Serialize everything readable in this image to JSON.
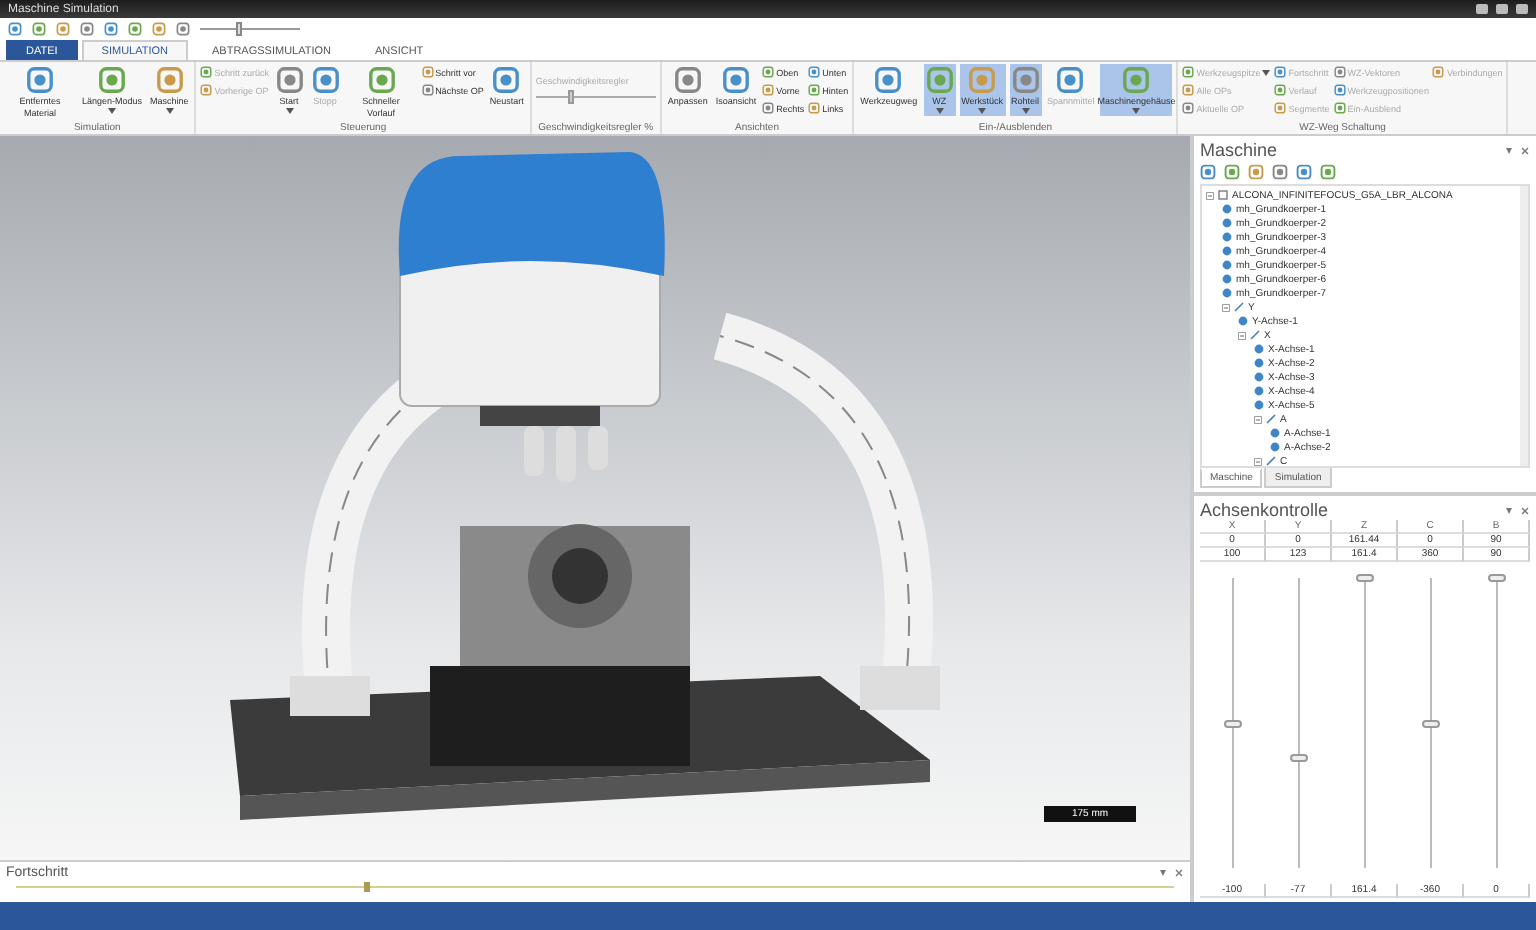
{
  "window": {
    "title": "Maschine Simulation"
  },
  "quick_access": {
    "slider": {
      "level": 0.35
    }
  },
  "tabs": [
    {
      "label": "DATEI",
      "kind": "file",
      "selected": false
    },
    {
      "label": "SIMULATION",
      "kind": "tab",
      "selected": true
    },
    {
      "label": "ABTRAGSSIMULATION",
      "kind": "tab",
      "selected": false
    },
    {
      "label": "ANSICHT",
      "kind": "tab",
      "selected": false
    }
  ],
  "ribbon": {
    "groups": [
      {
        "label": "Simulation",
        "items": [
          {
            "label": "Entferntes Material",
            "kind": "large",
            "disabled": false,
            "selected": false,
            "dropdown": false
          },
          {
            "label": "Längen-Modus",
            "kind": "large",
            "disabled": false,
            "selected": false,
            "dropdown": true
          },
          {
            "label": "Maschine",
            "kind": "large",
            "disabled": false,
            "selected": false,
            "dropdown": true
          }
        ]
      },
      {
        "label": "Steuerung",
        "items": [
          {
            "label": "Schritt zurück",
            "kind": "small",
            "disabled": true,
            "selected": false,
            "dropdown": false
          },
          {
            "label": "Vorherige OP",
            "kind": "small",
            "disabled": true,
            "selected": false,
            "dropdown": false
          },
          {
            "label": "Start",
            "kind": "large",
            "disabled": false,
            "selected": false,
            "dropdown": true
          },
          {
            "label": "Stopp",
            "kind": "large",
            "disabled": true,
            "selected": false,
            "dropdown": false
          },
          {
            "label": "Schneller Vorlauf",
            "kind": "large",
            "disabled": false,
            "selected": false,
            "dropdown": false
          },
          {
            "label": "Schritt vor",
            "kind": "small",
            "disabled": false,
            "selected": false,
            "dropdown": false
          },
          {
            "label": "Nächste OP",
            "kind": "small",
            "disabled": false,
            "selected": false,
            "dropdown": false
          },
          {
            "label": "Neustart",
            "kind": "large",
            "disabled": false,
            "selected": false,
            "dropdown": false
          }
        ]
      },
      {
        "label": "Geschwindigkeitsregler %",
        "items": [
          {
            "label": "Geschwindigkeitsregler",
            "kind": "slider",
            "level": 0.3,
            "disabled": true
          }
        ]
      },
      {
        "label": "Ansichten",
        "items": [
          {
            "label": "Anpassen",
            "kind": "large",
            "disabled": false,
            "selected": false,
            "dropdown": false
          },
          {
            "label": "Isoansicht",
            "kind": "large",
            "disabled": false,
            "selected": false,
            "dropdown": false
          },
          {
            "label": "Oben",
            "kind": "small",
            "disabled": false,
            "selected": false,
            "dropdown": false
          },
          {
            "label": "Vorne",
            "kind": "small",
            "disabled": false,
            "selected": false,
            "dropdown": false
          },
          {
            "label": "Rechts",
            "kind": "small",
            "disabled": false,
            "selected": false,
            "dropdown": false
          },
          {
            "label": "Unten",
            "kind": "small",
            "disabled": false,
            "selected": false,
            "dropdown": false
          },
          {
            "label": "Hinten",
            "kind": "small",
            "disabled": false,
            "selected": false,
            "dropdown": false
          },
          {
            "label": "Links",
            "kind": "small",
            "disabled": false,
            "selected": false,
            "dropdown": false
          }
        ]
      },
      {
        "label": "Ein-/Ausblenden",
        "items": [
          {
            "label": "Werkzeugweg",
            "kind": "large",
            "disabled": false,
            "selected": false,
            "dropdown": false
          },
          {
            "label": "WZ",
            "kind": "large",
            "disabled": false,
            "selected": true,
            "dropdown": true
          },
          {
            "label": "Werkstück",
            "kind": "large",
            "disabled": false,
            "selected": true,
            "dropdown": true
          },
          {
            "label": "Rohteil",
            "kind": "large",
            "disabled": false,
            "selected": true,
            "dropdown": true
          },
          {
            "label": "Spannmittel",
            "kind": "large",
            "disabled": true,
            "selected": false,
            "dropdown": false
          },
          {
            "label": "Maschinengehäuse",
            "kind": "large",
            "disabled": false,
            "selected": true,
            "dropdown": true
          }
        ]
      },
      {
        "label": "WZ-Weg Schaltung",
        "items": [
          {
            "label": "Werkzeugspitze",
            "kind": "small",
            "disabled": true,
            "selected": false,
            "dropdown": true
          },
          {
            "label": "Alle OPs",
            "kind": "small",
            "disabled": true,
            "selected": false,
            "dropdown": false
          },
          {
            "label": "Aktuelle OP",
            "kind": "small",
            "disabled": true,
            "selected": false,
            "dropdown": false
          },
          {
            "label": "Fortschritt",
            "kind": "small",
            "disabled": true,
            "selected": false,
            "dropdown": false
          },
          {
            "label": "Verlauf",
            "kind": "small",
            "disabled": true,
            "selected": false,
            "dropdown": false
          },
          {
            "label": "Segmente",
            "kind": "small",
            "disabled": true,
            "selected": false,
            "dropdown": false
          },
          {
            "label": "WZ-Vektoren",
            "kind": "small",
            "disabled": true,
            "selected": false,
            "dropdown": false
          },
          {
            "label": "Werkzeugpositionen",
            "kind": "small",
            "disabled": true,
            "selected": false,
            "dropdown": false
          },
          {
            "label": "Ein-Ausblend",
            "kind": "small",
            "disabled": true,
            "selected": false,
            "dropdown": false
          },
          {
            "label": "Verbindungen",
            "kind": "small",
            "disabled": true,
            "selected": false,
            "dropdown": false
          }
        ]
      }
    ]
  },
  "viewport": {
    "scale_label": "175 mm"
  },
  "machine_panel": {
    "title": "Maschine",
    "tree": [
      {
        "label": "ALCONA_INFINITEFOCUS_G5A_LBR_ALCONA",
        "kind": "root",
        "expanded": true,
        "children": [
          {
            "label": "mh_Grundkoerper-1",
            "kind": "body"
          },
          {
            "label": "mh_Grundkoerper-2",
            "kind": "body"
          },
          {
            "label": "mh_Grundkoerper-3",
            "kind": "body"
          },
          {
            "label": "mh_Grundkoerper-4",
            "kind": "body"
          },
          {
            "label": "mh_Grundkoerper-5",
            "kind": "body"
          },
          {
            "label": "mh_Grundkoerper-6",
            "kind": "body"
          },
          {
            "label": "mh_Grundkoerper-7",
            "kind": "body"
          },
          {
            "label": "Y",
            "kind": "axis",
            "expanded": true,
            "children": [
              {
                "label": "Y-Achse-1",
                "kind": "body"
              },
              {
                "label": "X",
                "kind": "axis",
                "expanded": true,
                "children": [
                  {
                    "label": "X-Achse-1",
                    "kind": "body"
                  },
                  {
                    "label": "X-Achse-2",
                    "kind": "body"
                  },
                  {
                    "label": "X-Achse-3",
                    "kind": "body"
                  },
                  {
                    "label": "X-Achse-4",
                    "kind": "body"
                  },
                  {
                    "label": "X-Achse-5",
                    "kind": "body"
                  },
                  {
                    "label": "A",
                    "kind": "axis",
                    "expanded": true,
                    "children": [
                      {
                        "label": "A-Achse-1",
                        "kind": "body"
                      },
                      {
                        "label": "A-Achse-2",
                        "kind": "body"
                      }
                    ]
                  },
                  {
                    "label": "C",
                    "kind": "axis",
                    "expanded": true
                  }
                ]
              }
            ]
          }
        ]
      }
    ],
    "tabs": [
      {
        "label": "Maschine",
        "selected": true
      },
      {
        "label": "Simulation",
        "selected": false
      }
    ]
  },
  "axis_panel": {
    "title": "Achsenkontrolle",
    "columns": [
      "X",
      "Y",
      "Z",
      "C",
      "B"
    ],
    "rows": [
      [
        "0",
        "0",
        "161.44",
        "0",
        "90"
      ],
      [
        "100",
        "123",
        "161.4",
        "360",
        "90"
      ]
    ],
    "sliders": [
      {
        "level": 0.5
      },
      {
        "level": 0.38
      },
      {
        "level": 1
      },
      {
        "level": 0.5
      },
      {
        "level": 1
      }
    ],
    "footer": [
      "-100",
      "-77",
      "161.4",
      "-360",
      "0"
    ]
  },
  "progress_panel": {
    "title": "Fortschritt",
    "level": 0.3
  }
}
